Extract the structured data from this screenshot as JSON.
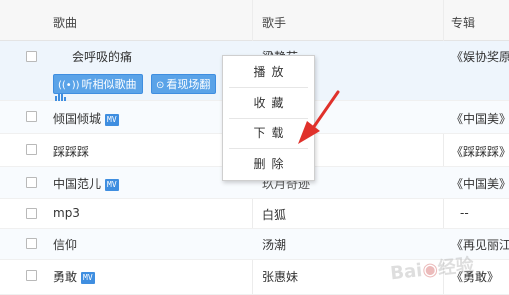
{
  "header": {
    "song": "歌曲",
    "artist": "歌手",
    "album": "专辑"
  },
  "rows": [
    {
      "title": "会呼吸的痛",
      "artist": "梁静茹",
      "album": "《娱协奖原",
      "mv": false
    },
    {
      "title": "倾国倾城",
      "artist": "",
      "album": "《中国美》",
      "mv": true
    },
    {
      "title": "踩踩踩",
      "artist": "",
      "album": "《踩踩踩》",
      "mv": false
    },
    {
      "title": "中国范儿",
      "artist": "玖月奇迹",
      "album": "《中国美》",
      "mv": true
    },
    {
      "title": "mp3",
      "artist": "白狐",
      "album": "--",
      "mv": false
    },
    {
      "title": "信仰",
      "artist": "汤潮",
      "album": "《再见丽江",
      "mv": false
    },
    {
      "title": "勇敢",
      "artist": "张惠妹",
      "album": "《勇敢》",
      "mv": true
    }
  ],
  "tag_label": "MV",
  "actions": {
    "similar": "听相似歌曲",
    "live": "看现场翻"
  },
  "context_menu": {
    "play": "播放",
    "favorite": "收藏",
    "download": "下载",
    "delete": "删除"
  },
  "watermark": "Baidu经验",
  "colors": {
    "accent": "#3f8ee0",
    "arrow": "#e0312b"
  }
}
